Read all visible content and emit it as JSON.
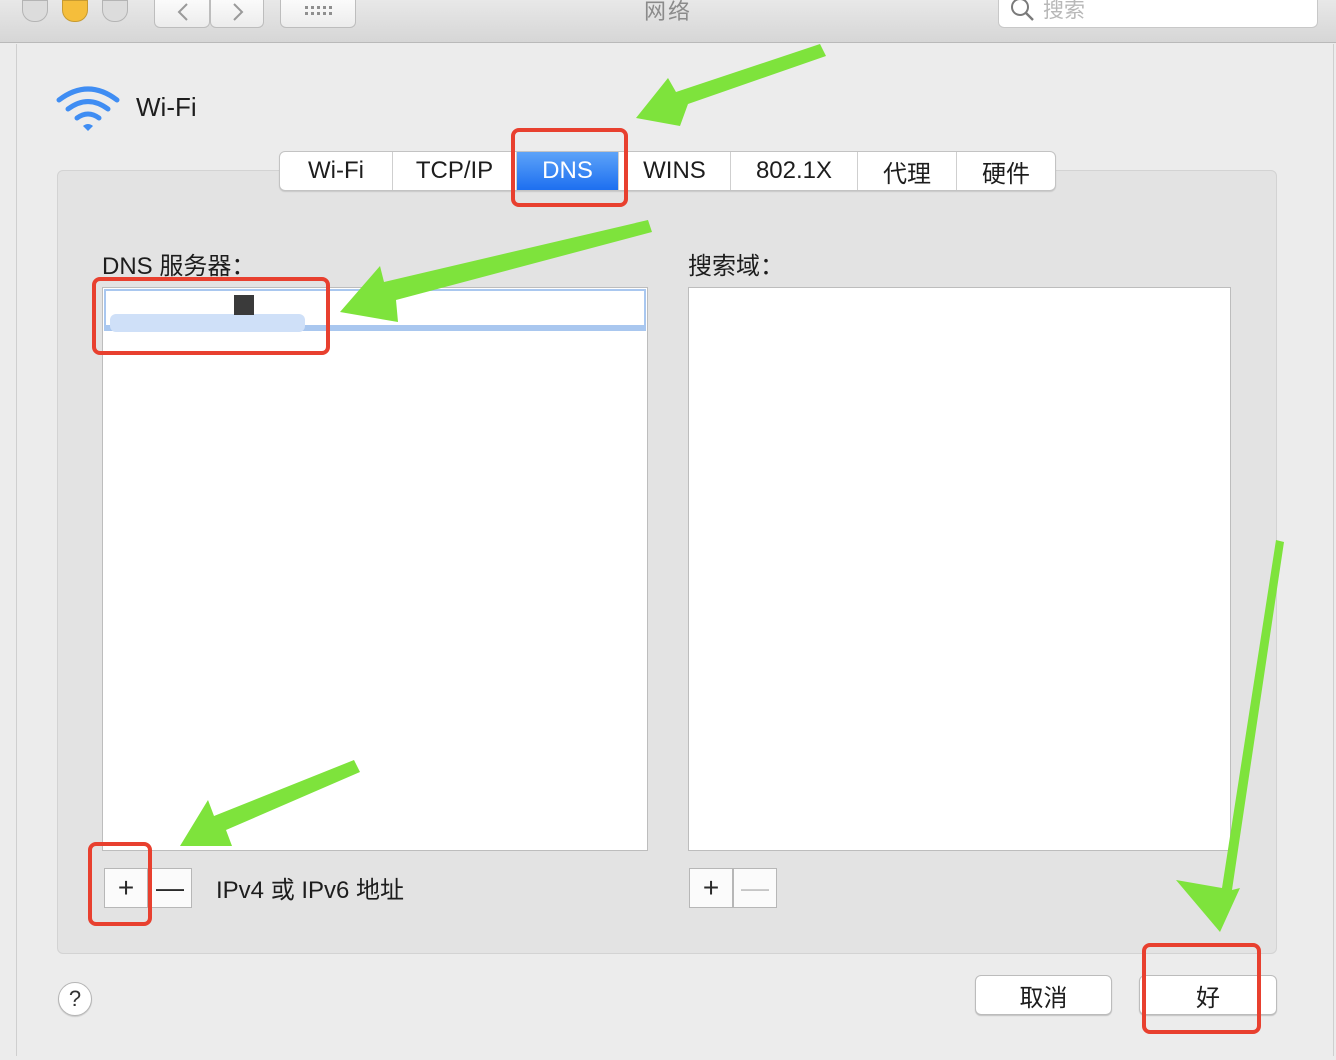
{
  "window": {
    "title": "网络",
    "search_placeholder": "搜索"
  },
  "interface": {
    "name": "Wi-Fi"
  },
  "tabs": [
    {
      "label": "Wi-Fi",
      "active": false
    },
    {
      "label": "TCP/IP",
      "active": false
    },
    {
      "label": "DNS",
      "active": true
    },
    {
      "label": "WINS",
      "active": false
    },
    {
      "label": "802.1X",
      "active": false
    },
    {
      "label": "代理",
      "active": false
    },
    {
      "label": "硬件",
      "active": false
    }
  ],
  "dns_servers": {
    "label": "DNS 服务器：",
    "entries": [
      {
        "value": ""
      }
    ],
    "hint": "IPv4 或 IPv6 地址"
  },
  "search_domains": {
    "label": "搜索域：",
    "entries": []
  },
  "buttons": {
    "add": "+",
    "remove": "—",
    "cancel": "取消",
    "ok": "好",
    "help": "?"
  },
  "colors": {
    "accent": "#1d6ff0",
    "annotation_box": "#e8402f",
    "annotation_arrow": "#7ee33c"
  }
}
